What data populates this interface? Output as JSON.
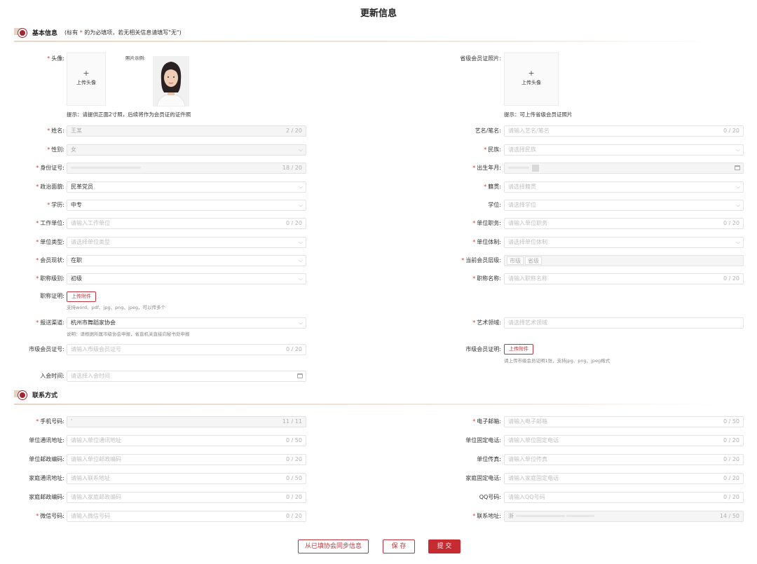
{
  "page_title": "更新信息",
  "section_basic": {
    "title": "基本信息",
    "note_prefix": "(标有",
    "note_star": "*",
    "note_suffix": "的为必填项，若无相关信息请填写\"无\")"
  },
  "section_contact": {
    "title": "联系方式"
  },
  "avatar": {
    "label": "头像:",
    "upload_plus": "+",
    "upload_text": "上传头像",
    "example_label": "照片示例:",
    "hint": "提示：请提供正面2寸照，后续将作为会员证的证件照"
  },
  "provincial_card": {
    "label": "省级会员证照片:",
    "upload_plus": "+",
    "upload_text": "上传头像",
    "hint": "提示：可上传省级会员证照片"
  },
  "fields": {
    "name": {
      "label": "姓名:",
      "value": "王某",
      "count": "2 / 20"
    },
    "artname": {
      "label": "艺名/笔名:",
      "placeholder": "请输入艺名/笔名",
      "count": "0 / 20"
    },
    "gender": {
      "label": "性别:",
      "value": "女"
    },
    "ethnicity": {
      "label": "民族:",
      "placeholder": "请选择民族"
    },
    "idcard": {
      "label": "身份证号:",
      "count": "18 / 20"
    },
    "birth": {
      "label": "出生年月:"
    },
    "politics": {
      "label": "政治面貌:",
      "value": "民革党员"
    },
    "native": {
      "label": "籍贯:",
      "placeholder": "请选择籍贯"
    },
    "education": {
      "label": "学历:",
      "value": "中专"
    },
    "degree": {
      "label": "学位:",
      "placeholder": "请选择学位"
    },
    "workplace": {
      "label": "工作单位:",
      "placeholder": "请输入工作单位",
      "count": "0 / 20"
    },
    "position": {
      "label": "单位职务:",
      "placeholder": "请输入单位职务",
      "count": "0 / 20"
    },
    "unit_type": {
      "label": "单位类型:",
      "placeholder": "请选择单位类型"
    },
    "unit_system": {
      "label": "单位体制:",
      "placeholder": "请选择单位体制"
    },
    "member_status": {
      "label": "会员现状:",
      "value": "在职"
    },
    "member_level": {
      "label": "当前会员层级:",
      "tags": [
        "市级",
        "省级"
      ]
    },
    "title_level": {
      "label": "职称级别:",
      "value": "初级"
    },
    "title_name": {
      "label": "职称名称:",
      "placeholder": "请输入职称名称",
      "count": "0 / 20"
    },
    "title_cert": {
      "label": "职称证明:",
      "button": "上传附件",
      "hint": "支持word、pdf、jpg、png、jpeg，可以传多个"
    },
    "channel": {
      "label": "报送渠道:",
      "value": "杭州市舞蹈家协会",
      "hint": "说明：请根据所属市级协会申报，省直机关直接向秘书处申报"
    },
    "art_field": {
      "label": "艺术领域:",
      "placeholder": "请选择艺术领域"
    },
    "city_card_no": {
      "label": "市级会员证号:",
      "placeholder": "请输入市级会员证号",
      "count": "0 / 20"
    },
    "city_card": {
      "label": "市级会员证明:",
      "button": "上传附件",
      "hint": "请上传市级会员证明1张，支持jpg、png、jpeg格式"
    },
    "join_time": {
      "label": "入会时间:",
      "placeholder": "请选择入会时间"
    },
    "phone": {
      "label": "手机号码:",
      "value": "'",
      "count": "11 / 11"
    },
    "email": {
      "label": "电子邮箱:",
      "placeholder": "请输入电子邮箱",
      "count": "0 / 50"
    },
    "unit_address": {
      "label": "单位通讯地址:",
      "placeholder": "请输入单位通讯地址",
      "count": "0 / 50"
    },
    "unit_phone": {
      "label": "单位固定电话:",
      "placeholder": "请输入单位固定电话",
      "count": "0 / 20"
    },
    "unit_zip": {
      "label": "单位邮政编码:",
      "placeholder": "请输入单位邮政编码",
      "count": "0 / 20"
    },
    "unit_fax": {
      "label": "单位传真:",
      "placeholder": "请输入单位传真",
      "count": "0 / 20"
    },
    "home_address": {
      "label": "家庭通讯地址:",
      "placeholder": "请输入联系地址",
      "count": "0 / 50"
    },
    "home_phone": {
      "label": "家庭固定电话:",
      "placeholder": "请输入家庭固定电话",
      "count": "0 / 20"
    },
    "home_zip": {
      "label": "家庭邮政编码:",
      "placeholder": "请输入家庭邮政编码",
      "count": "0 / 20"
    },
    "qq": {
      "label": "QQ号码:",
      "placeholder": "请输入QQ号码",
      "count": "0 / 20"
    },
    "wechat": {
      "label": "微信号码:",
      "placeholder": "请输入微信号码",
      "count": "0 / 20"
    },
    "contact_address": {
      "label": "联系地址:",
      "value": "浙",
      "count": "14 / 50"
    }
  },
  "buttons": {
    "sync": "从已填协会同步信息",
    "save": "保 存",
    "submit": "提 交"
  }
}
